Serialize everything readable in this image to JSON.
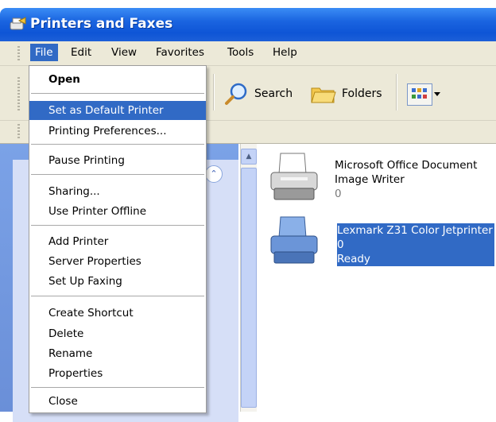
{
  "window": {
    "title": "Printers and Faxes"
  },
  "menubar": {
    "items": [
      "File",
      "Edit",
      "View",
      "Favorites",
      "Tools",
      "Help"
    ]
  },
  "toolbar": {
    "search_label": "Search",
    "folders_label": "Folders"
  },
  "file_menu": {
    "items": [
      "Open",
      "Set as Default Printer",
      "Printing Preferences...",
      "Pause Printing",
      "Sharing...",
      "Use Printer Offline",
      "Add Printer",
      "Server Properties",
      "Set Up Faxing",
      "Create Shortcut",
      "Delete",
      "Rename",
      "Properties",
      "Close"
    ]
  },
  "printers": [
    {
      "name_line1": "Microsoft Office Document",
      "name_line2": "Image Writer",
      "jobs": "0",
      "status": ""
    },
    {
      "name_line1": "Lexmark Z31 Color Jetprinter",
      "jobs": "0",
      "status": "Ready"
    }
  ],
  "colors": {
    "selection": "#316ac5",
    "titlebar": "#1a64e0",
    "menu_bg": "#ece9d8"
  }
}
